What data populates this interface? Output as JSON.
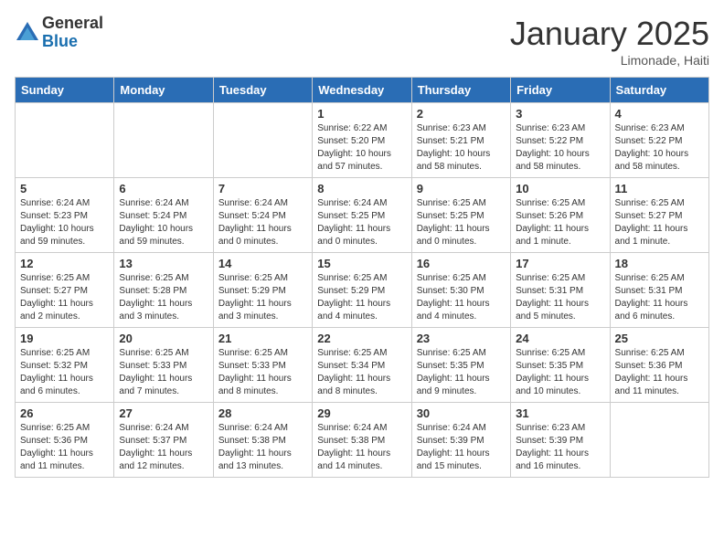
{
  "logo": {
    "general": "General",
    "blue": "Blue"
  },
  "header": {
    "month": "January 2025",
    "location": "Limonade, Haiti"
  },
  "days_of_week": [
    "Sunday",
    "Monday",
    "Tuesday",
    "Wednesday",
    "Thursday",
    "Friday",
    "Saturday"
  ],
  "weeks": [
    [
      {
        "day": "",
        "info": ""
      },
      {
        "day": "",
        "info": ""
      },
      {
        "day": "",
        "info": ""
      },
      {
        "day": "1",
        "info": "Sunrise: 6:22 AM\nSunset: 5:20 PM\nDaylight: 10 hours and 57 minutes."
      },
      {
        "day": "2",
        "info": "Sunrise: 6:23 AM\nSunset: 5:21 PM\nDaylight: 10 hours and 58 minutes."
      },
      {
        "day": "3",
        "info": "Sunrise: 6:23 AM\nSunset: 5:22 PM\nDaylight: 10 hours and 58 minutes."
      },
      {
        "day": "4",
        "info": "Sunrise: 6:23 AM\nSunset: 5:22 PM\nDaylight: 10 hours and 58 minutes."
      }
    ],
    [
      {
        "day": "5",
        "info": "Sunrise: 6:24 AM\nSunset: 5:23 PM\nDaylight: 10 hours and 59 minutes."
      },
      {
        "day": "6",
        "info": "Sunrise: 6:24 AM\nSunset: 5:24 PM\nDaylight: 10 hours and 59 minutes."
      },
      {
        "day": "7",
        "info": "Sunrise: 6:24 AM\nSunset: 5:24 PM\nDaylight: 11 hours and 0 minutes."
      },
      {
        "day": "8",
        "info": "Sunrise: 6:24 AM\nSunset: 5:25 PM\nDaylight: 11 hours and 0 minutes."
      },
      {
        "day": "9",
        "info": "Sunrise: 6:25 AM\nSunset: 5:25 PM\nDaylight: 11 hours and 0 minutes."
      },
      {
        "day": "10",
        "info": "Sunrise: 6:25 AM\nSunset: 5:26 PM\nDaylight: 11 hours and 1 minute."
      },
      {
        "day": "11",
        "info": "Sunrise: 6:25 AM\nSunset: 5:27 PM\nDaylight: 11 hours and 1 minute."
      }
    ],
    [
      {
        "day": "12",
        "info": "Sunrise: 6:25 AM\nSunset: 5:27 PM\nDaylight: 11 hours and 2 minutes."
      },
      {
        "day": "13",
        "info": "Sunrise: 6:25 AM\nSunset: 5:28 PM\nDaylight: 11 hours and 3 minutes."
      },
      {
        "day": "14",
        "info": "Sunrise: 6:25 AM\nSunset: 5:29 PM\nDaylight: 11 hours and 3 minutes."
      },
      {
        "day": "15",
        "info": "Sunrise: 6:25 AM\nSunset: 5:29 PM\nDaylight: 11 hours and 4 minutes."
      },
      {
        "day": "16",
        "info": "Sunrise: 6:25 AM\nSunset: 5:30 PM\nDaylight: 11 hours and 4 minutes."
      },
      {
        "day": "17",
        "info": "Sunrise: 6:25 AM\nSunset: 5:31 PM\nDaylight: 11 hours and 5 minutes."
      },
      {
        "day": "18",
        "info": "Sunrise: 6:25 AM\nSunset: 5:31 PM\nDaylight: 11 hours and 6 minutes."
      }
    ],
    [
      {
        "day": "19",
        "info": "Sunrise: 6:25 AM\nSunset: 5:32 PM\nDaylight: 11 hours and 6 minutes."
      },
      {
        "day": "20",
        "info": "Sunrise: 6:25 AM\nSunset: 5:33 PM\nDaylight: 11 hours and 7 minutes."
      },
      {
        "day": "21",
        "info": "Sunrise: 6:25 AM\nSunset: 5:33 PM\nDaylight: 11 hours and 8 minutes."
      },
      {
        "day": "22",
        "info": "Sunrise: 6:25 AM\nSunset: 5:34 PM\nDaylight: 11 hours and 8 minutes."
      },
      {
        "day": "23",
        "info": "Sunrise: 6:25 AM\nSunset: 5:35 PM\nDaylight: 11 hours and 9 minutes."
      },
      {
        "day": "24",
        "info": "Sunrise: 6:25 AM\nSunset: 5:35 PM\nDaylight: 11 hours and 10 minutes."
      },
      {
        "day": "25",
        "info": "Sunrise: 6:25 AM\nSunset: 5:36 PM\nDaylight: 11 hours and 11 minutes."
      }
    ],
    [
      {
        "day": "26",
        "info": "Sunrise: 6:25 AM\nSunset: 5:36 PM\nDaylight: 11 hours and 11 minutes."
      },
      {
        "day": "27",
        "info": "Sunrise: 6:24 AM\nSunset: 5:37 PM\nDaylight: 11 hours and 12 minutes."
      },
      {
        "day": "28",
        "info": "Sunrise: 6:24 AM\nSunset: 5:38 PM\nDaylight: 11 hours and 13 minutes."
      },
      {
        "day": "29",
        "info": "Sunrise: 6:24 AM\nSunset: 5:38 PM\nDaylight: 11 hours and 14 minutes."
      },
      {
        "day": "30",
        "info": "Sunrise: 6:24 AM\nSunset: 5:39 PM\nDaylight: 11 hours and 15 minutes."
      },
      {
        "day": "31",
        "info": "Sunrise: 6:23 AM\nSunset: 5:39 PM\nDaylight: 11 hours and 16 minutes."
      },
      {
        "day": "",
        "info": ""
      }
    ]
  ]
}
